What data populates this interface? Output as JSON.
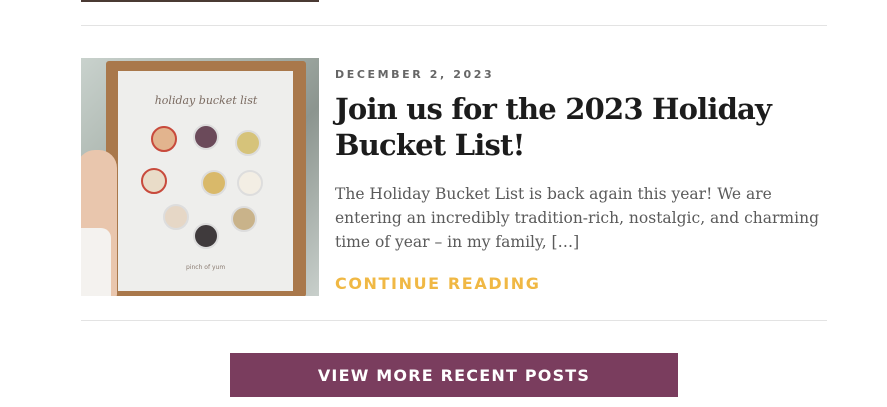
{
  "post": {
    "date": "DECEMBER 2, 2023",
    "title": "Join us for the 2023 Holiday Bucket List!",
    "excerpt": "The Holiday Bucket List is back again this year! We are entering an incredibly tradition-rich, nostalgic, and charming time of year – in my family, […]",
    "continue_label": "CONTINUE READING",
    "thumbnail": {
      "printed_title": "holiday bucket list",
      "footer_text": "pinch of yum"
    }
  },
  "actions": {
    "view_more_label": "VIEW MORE RECENT POSTS"
  },
  "colors": {
    "accent_link": "#f0b844",
    "button_bg": "#7a3d5e",
    "title_text": "#1c1c1c",
    "body_text": "#5a5a5a",
    "meta_text": "#666666",
    "divider": "#e3e3e3"
  }
}
